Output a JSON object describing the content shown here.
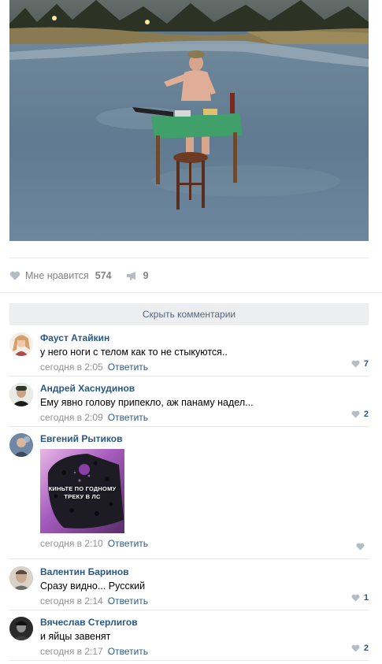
{
  "post": {
    "actions": {
      "like_label": "Мне нравится",
      "like_count": "574",
      "share_count": "9"
    },
    "hide_comments_label": "Скрыть комментарии"
  },
  "comments": [
    {
      "author": "Фауст Атайкин",
      "text": "у него ноги с телом как то не стыкуются..",
      "time": "сегодня в 2:05",
      "reply": "Ответить",
      "likes": "7"
    },
    {
      "author": "Андрей Хаснудинов",
      "text": "Ему явно голову припекло, аж панаму надел...",
      "time": "сегодня в 2:09",
      "reply": "Ответить",
      "likes": "2"
    },
    {
      "author": "Евгений Рытиков",
      "attachment_caption": "КИНЬТЕ ПО ГОДНОМУ ТРЕКУ В ЛС",
      "time": "сегодня в 2:10",
      "reply": "Ответить",
      "likes": ""
    },
    {
      "author": "Валентин Баринов",
      "text": "Сразу видно... Русский",
      "time": "сегодня в 2:14",
      "reply": "Ответить",
      "likes": "1"
    },
    {
      "author": "Вячеслав Стерлигов",
      "text": "и яйцы завенят",
      "time": "сегодня в 2:17",
      "reply": "Ответить",
      "likes": "2"
    }
  ],
  "colors": {
    "link": "#2a5885",
    "muted": "#939393",
    "button_bg": "#edeef0"
  }
}
